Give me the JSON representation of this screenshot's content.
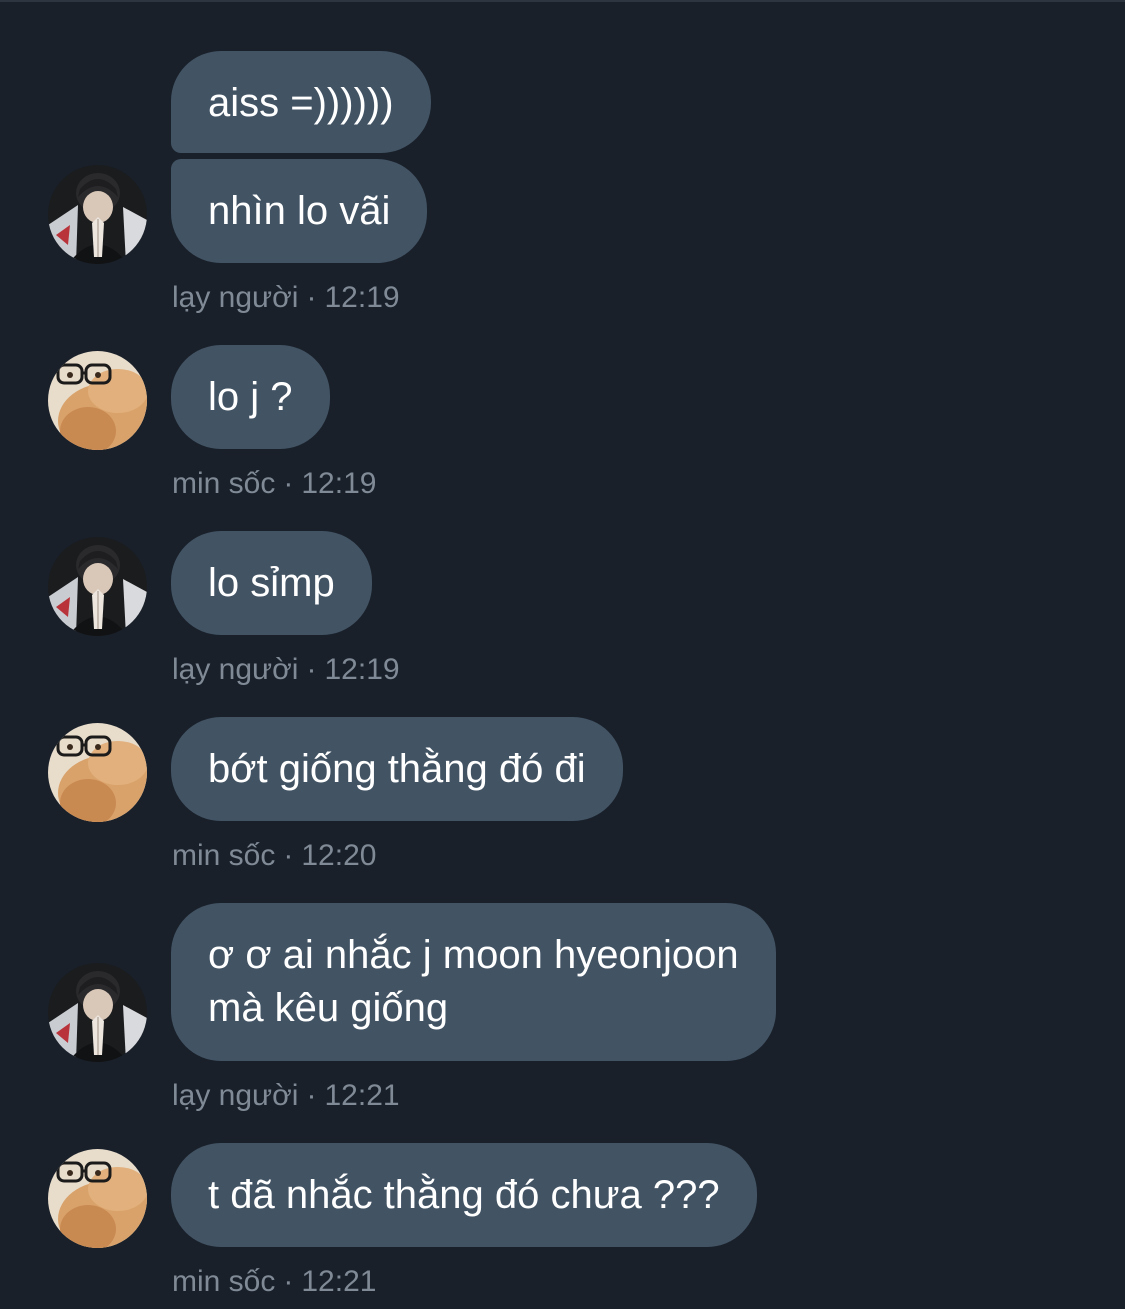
{
  "colors": {
    "background": "#19202a",
    "bubble": "#425364",
    "meta_text": "#7f8a96",
    "message_text": "#ffffff"
  },
  "messages": [
    {
      "sender": "lay-nguoi",
      "text": "aiss =))))))"
    },
    {
      "sender": "lay-nguoi",
      "text": "nhìn lo vãi"
    },
    {
      "sender": "min-soc",
      "text": "lo j ?"
    },
    {
      "sender": "lay-nguoi",
      "text": "lo sỉmp"
    },
    {
      "sender": "min-soc",
      "text": "bớt giống thằng đó đi"
    },
    {
      "sender": "lay-nguoi",
      "line1": "ơ ơ ai nhắc j moon hyeonjoon",
      "line2": "mà kêu giống"
    },
    {
      "sender": "min-soc",
      "text": "t đã nhắc thằng đó chưa ???"
    }
  ],
  "meta": [
    {
      "name": "lạy người",
      "sep": "·",
      "time": "12:19"
    },
    {
      "name": "min sốc",
      "sep": "·",
      "time": "12:19"
    },
    {
      "name": "lạy người",
      "sep": "·",
      "time": "12:19"
    },
    {
      "name": "min sốc",
      "sep": "·",
      "time": "12:20"
    },
    {
      "name": "lạy người",
      "sep": "·",
      "time": "12:21"
    },
    {
      "name": "min sốc",
      "sep": "·",
      "time": "12:21"
    }
  ],
  "avatars": {
    "lay_nguoi": "person-praying-avatar",
    "min_soc": "rabbit-with-glasses-avatar"
  }
}
